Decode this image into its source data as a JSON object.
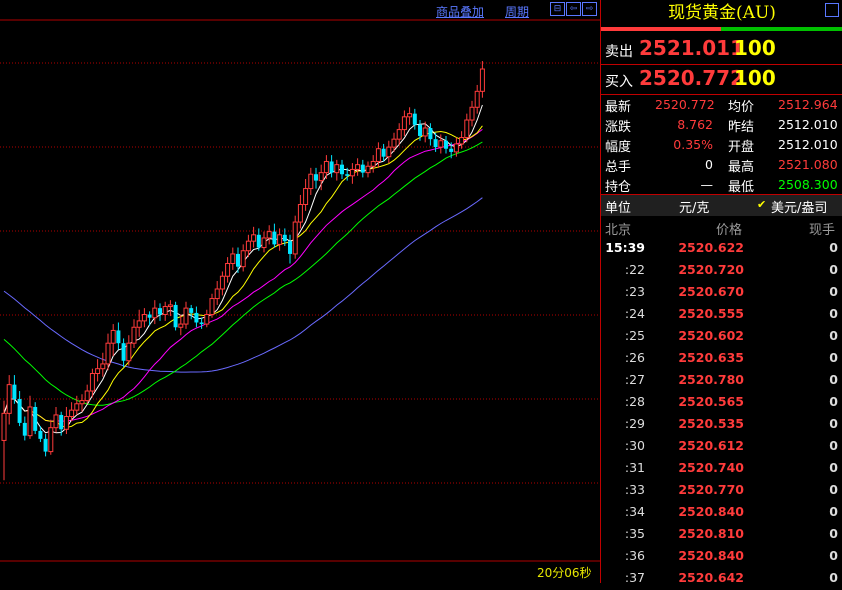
{
  "toolbar": {
    "overlay_label": "商品叠加",
    "period_label": "周期",
    "nav_buttons": [
      "⊟",
      "⇦",
      "⇨",
      "⊡"
    ]
  },
  "chart_status": {
    "duration": "20分06秒"
  },
  "colors": {
    "up": "#ff3b3b",
    "down": "#00e5ff",
    "ma5": "#ffffff",
    "ma10": "#ffff00",
    "ma20": "#ff00ff",
    "ma60": "#00ff00",
    "ma120": "#6a6aff",
    "grid": "#b00000"
  },
  "chart_data": {
    "type": "candlestick",
    "series": [
      {
        "name": "candles",
        "values": [
          [
            2503.5,
            2505.2,
            2501.0,
            2506.0
          ],
          [
            2505.2,
            2507.0,
            2504.5,
            2507.6
          ],
          [
            2507.0,
            2506.1,
            2505.8,
            2507.6
          ],
          [
            2506.1,
            2504.6,
            2504.4,
            2506.6
          ],
          [
            2504.6,
            2503.8,
            2503.5,
            2505.0
          ],
          [
            2503.8,
            2505.6,
            2503.6,
            2506.3
          ],
          [
            2505.6,
            2504.1,
            2503.9,
            2505.9
          ],
          [
            2504.1,
            2503.6,
            2503.4,
            2504.4
          ],
          [
            2503.6,
            2502.8,
            2502.5,
            2503.9
          ],
          [
            2502.8,
            2504.3,
            2502.6,
            2504.8
          ],
          [
            2504.3,
            2505.1,
            2504.0,
            2505.6
          ],
          [
            2505.1,
            2504.2,
            2503.8,
            2505.3
          ],
          [
            2504.2,
            2505.0,
            2503.9,
            2505.6
          ],
          [
            2505.0,
            2505.4,
            2504.7,
            2505.9
          ],
          [
            2505.4,
            2505.8,
            2505.1,
            2506.3
          ],
          [
            2505.8,
            2506.0,
            2505.3,
            2506.4
          ],
          [
            2506.0,
            2506.6,
            2505.8,
            2507.0
          ],
          [
            2506.6,
            2507.7,
            2506.2,
            2508.0
          ],
          [
            2507.7,
            2508.0,
            2507.2,
            2508.6
          ],
          [
            2508.0,
            2508.3,
            2507.5,
            2509.0
          ],
          [
            2508.3,
            2509.6,
            2507.9,
            2510.2
          ],
          [
            2509.6,
            2510.4,
            2508.8,
            2510.8
          ],
          [
            2510.4,
            2509.6,
            2509.2,
            2510.9
          ],
          [
            2509.6,
            2508.5,
            2508.1,
            2509.9
          ],
          [
            2508.5,
            2509.6,
            2508.2,
            2510.1
          ],
          [
            2509.6,
            2510.6,
            2509.3,
            2511.1
          ],
          [
            2510.6,
            2511.0,
            2510.0,
            2511.7
          ],
          [
            2511.0,
            2511.4,
            2510.6,
            2511.8
          ],
          [
            2511.4,
            2511.2,
            2510.7,
            2511.6
          ],
          [
            2511.2,
            2511.8,
            2510.8,
            2512.3
          ],
          [
            2511.8,
            2511.4,
            2511.0,
            2512.1
          ],
          [
            2511.4,
            2511.9,
            2511.0,
            2512.2
          ],
          [
            2511.9,
            2512.0,
            2511.3,
            2512.3
          ],
          [
            2512.0,
            2510.6,
            2510.4,
            2512.2
          ],
          [
            2510.6,
            2510.8,
            2510.1,
            2511.4
          ],
          [
            2510.8,
            2511.8,
            2510.5,
            2512.2
          ],
          [
            2511.8,
            2511.5,
            2511.1,
            2512.0
          ],
          [
            2511.5,
            2510.9,
            2510.6,
            2511.9
          ],
          [
            2510.9,
            2510.8,
            2510.5,
            2511.2
          ],
          [
            2510.8,
            2511.4,
            2510.6,
            2511.7
          ],
          [
            2511.4,
            2512.4,
            2511.2,
            2512.7
          ],
          [
            2512.4,
            2513.0,
            2512.0,
            2513.5
          ],
          [
            2513.0,
            2513.8,
            2512.6,
            2514.1
          ],
          [
            2513.8,
            2514.6,
            2513.4,
            2515.0
          ],
          [
            2514.6,
            2515.2,
            2514.2,
            2515.6
          ],
          [
            2515.2,
            2514.4,
            2514.0,
            2515.6
          ],
          [
            2514.4,
            2515.4,
            2514.1,
            2515.8
          ],
          [
            2515.4,
            2516.0,
            2515.0,
            2516.4
          ],
          [
            2516.0,
            2516.4,
            2515.6,
            2516.9
          ],
          [
            2516.4,
            2515.6,
            2515.4,
            2516.8
          ],
          [
            2515.6,
            2516.2,
            2515.3,
            2516.6
          ],
          [
            2516.2,
            2516.6,
            2515.8,
            2517.0
          ],
          [
            2516.6,
            2515.8,
            2515.6,
            2517.1
          ],
          [
            2515.8,
            2516.4,
            2515.4,
            2516.8
          ],
          [
            2516.4,
            2516.0,
            2515.7,
            2516.8
          ],
          [
            2516.0,
            2515.2,
            2514.6,
            2516.4
          ],
          [
            2515.2,
            2517.2,
            2514.9,
            2517.6
          ],
          [
            2517.2,
            2518.3,
            2516.8,
            2518.9
          ],
          [
            2518.3,
            2519.3,
            2517.9,
            2519.9
          ],
          [
            2519.3,
            2520.2,
            2518.9,
            2520.6
          ],
          [
            2520.2,
            2519.8,
            2519.3,
            2520.6
          ],
          [
            2519.8,
            2520.3,
            2519.2,
            2520.8
          ],
          [
            2520.3,
            2521.0,
            2519.9,
            2521.4
          ],
          [
            2521.0,
            2520.3,
            2520.0,
            2521.4
          ],
          [
            2520.3,
            2520.8,
            2519.8,
            2521.1
          ],
          [
            2520.8,
            2520.2,
            2519.9,
            2521.1
          ],
          [
            2520.2,
            2520.1,
            2519.8,
            2520.6
          ],
          [
            2520.1,
            2520.5,
            2519.6,
            2520.9
          ],
          [
            2520.5,
            2520.8,
            2520.1,
            2521.2
          ],
          [
            2520.8,
            2520.3,
            2520.0,
            2521.1
          ],
          [
            2520.3,
            2520.7,
            2520.0,
            2521.0
          ],
          [
            2520.7,
            2521.0,
            2520.3,
            2521.4
          ],
          [
            2521.0,
            2521.8,
            2520.6,
            2522.2
          ],
          [
            2521.8,
            2521.3,
            2521.0,
            2522.1
          ],
          [
            2521.3,
            2521.9,
            2520.9,
            2522.3
          ],
          [
            2521.9,
            2522.4,
            2521.6,
            2522.8
          ],
          [
            2522.4,
            2523.0,
            2522.0,
            2523.4
          ],
          [
            2523.0,
            2523.8,
            2522.6,
            2524.2
          ],
          [
            2523.8,
            2524.0,
            2523.3,
            2524.4
          ],
          [
            2524.0,
            2523.3,
            2523.0,
            2524.3
          ],
          [
            2523.3,
            2522.6,
            2522.3,
            2523.6
          ],
          [
            2522.6,
            2523.1,
            2522.2,
            2523.5
          ],
          [
            2523.1,
            2522.4,
            2522.0,
            2523.4
          ],
          [
            2522.4,
            2521.9,
            2521.6,
            2522.8
          ],
          [
            2521.9,
            2522.3,
            2521.5,
            2522.7
          ],
          [
            2522.3,
            2521.8,
            2521.5,
            2522.6
          ],
          [
            2521.8,
            2521.6,
            2521.2,
            2522.2
          ],
          [
            2521.6,
            2522.1,
            2521.3,
            2522.5
          ],
          [
            2522.1,
            2522.5,
            2521.8,
            2522.9
          ],
          [
            2522.5,
            2523.6,
            2522.2,
            2524.0
          ],
          [
            2523.6,
            2524.4,
            2523.2,
            2524.8
          ],
          [
            2524.4,
            2525.4,
            2524.0,
            2525.8
          ],
          [
            2525.4,
            2526.8,
            2525.0,
            2527.3
          ]
        ]
      }
    ],
    "ma_lines": [
      "MA5",
      "MA10",
      "MA20",
      "MA60",
      "MA120"
    ],
    "ylim": [
      2496,
      2530
    ]
  },
  "panel": {
    "title": "现货黄金(AU)",
    "sell_label": "卖出",
    "sell_price": "2521.011",
    "sell_vol": "100",
    "buy_label": "买入",
    "buy_price": "2520.772",
    "buy_vol": "100",
    "stats": [
      {
        "label": "最新",
        "value": "2520.772",
        "label2": "均价",
        "value2": "2512.964",
        "c1": "#ff3b3b",
        "c2": "#ff3b3b"
      },
      {
        "label": "涨跌",
        "value": "8.762",
        "label2": "昨结",
        "value2": "2512.010",
        "c1": "#ff3b3b",
        "c2": "#ffffff"
      },
      {
        "label": "幅度",
        "value": "0.35%",
        "label2": "开盘",
        "value2": "2512.010",
        "c1": "#ff3b3b",
        "c2": "#ffffff"
      },
      {
        "label": "总手",
        "value": "0",
        "label2": "最高",
        "value2": "2521.080",
        "c1": "#ffffff",
        "c2": "#ff3b3b"
      },
      {
        "label": "持仓",
        "value": "—",
        "label2": "最低",
        "value2": "2508.300",
        "c1": "#ffffff",
        "c2": "#00ff00"
      }
    ],
    "unit_label": "单位",
    "unit_value": "元/克",
    "unit_alt": "美元/盎司",
    "unit_check": "✔",
    "tick_headers": {
      "location": "北京",
      "price": "价格",
      "qty": "现手"
    },
    "ticks": [
      {
        "time": "15:39",
        "price": "2520.622",
        "qty": "0"
      },
      {
        "time": ":22",
        "price": "2520.720",
        "qty": "0"
      },
      {
        "time": ":23",
        "price": "2520.670",
        "qty": "0"
      },
      {
        "time": ":24",
        "price": "2520.555",
        "qty": "0"
      },
      {
        "time": ":25",
        "price": "2520.602",
        "qty": "0"
      },
      {
        "time": ":26",
        "price": "2520.635",
        "qty": "0"
      },
      {
        "time": ":27",
        "price": "2520.780",
        "qty": "0"
      },
      {
        "time": ":28",
        "price": "2520.565",
        "qty": "0"
      },
      {
        "time": ":29",
        "price": "2520.535",
        "qty": "0"
      },
      {
        "time": ":30",
        "price": "2520.612",
        "qty": "0"
      },
      {
        "time": ":31",
        "price": "2520.740",
        "qty": "0"
      },
      {
        "time": ":33",
        "price": "2520.770",
        "qty": "0"
      },
      {
        "time": ":34",
        "price": "2520.840",
        "qty": "0"
      },
      {
        "time": ":35",
        "price": "2520.810",
        "qty": "0"
      },
      {
        "time": ":36",
        "price": "2520.840",
        "qty": "0"
      },
      {
        "time": ":37",
        "price": "2520.642",
        "qty": "0"
      }
    ]
  }
}
